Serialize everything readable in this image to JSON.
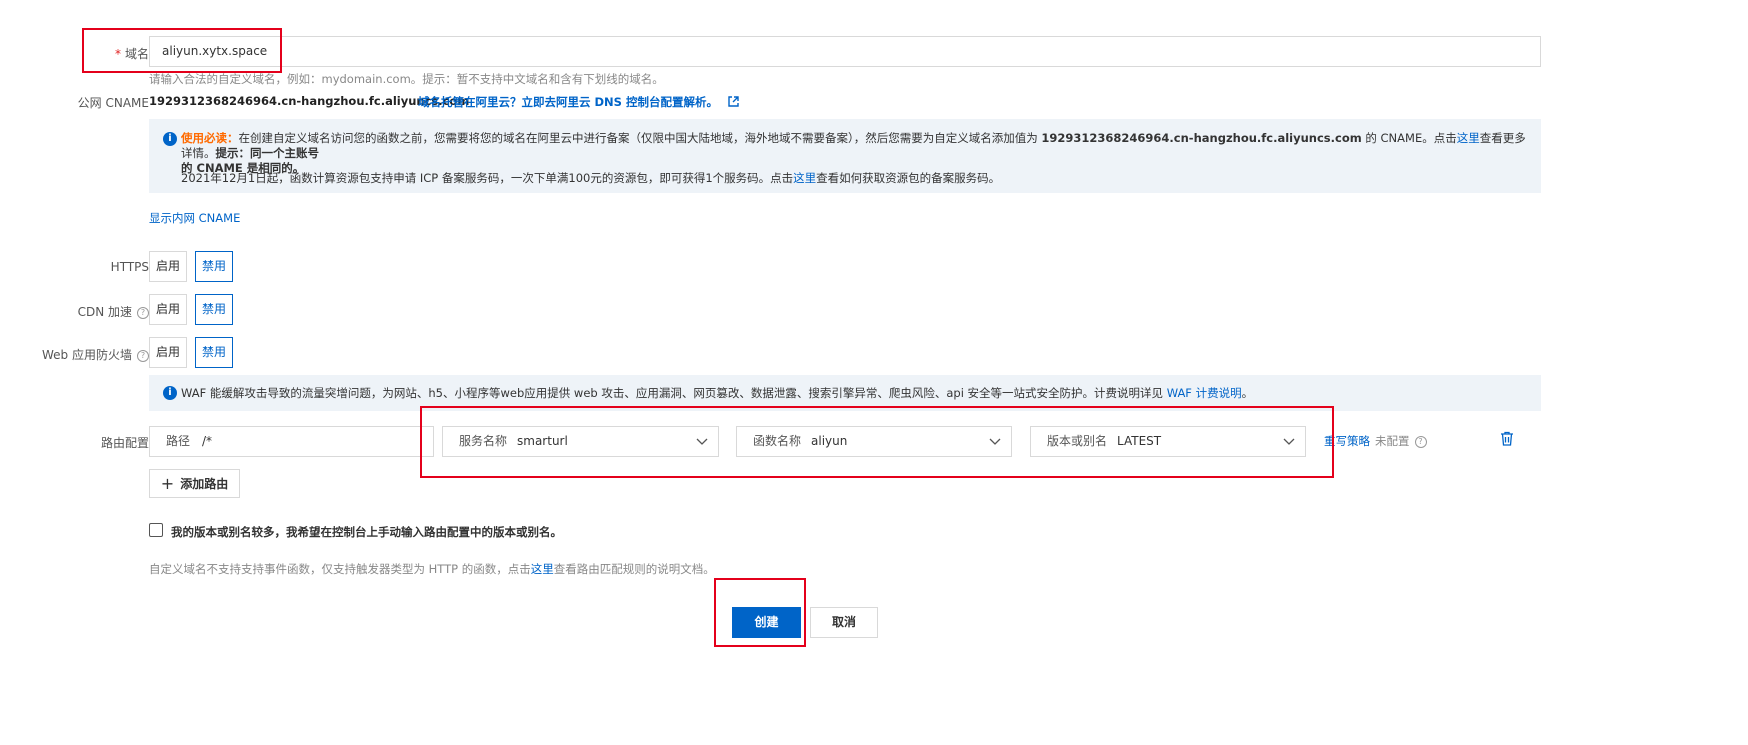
{
  "domain": {
    "label": "域名",
    "required_mark": "*",
    "value": "aliyun.xytx.space",
    "help": "请输入合法的自定义域名，例如：mydomain.com。提示：暂不支持中文域名和含有下划线的域名。"
  },
  "cname": {
    "label": "公网 CNAME",
    "value": "1929312368246964.cn-hangzhou.fc.aliyuncs.com",
    "dns_link": "域名托管在阿里云？立即去阿里云 DNS 控制台配置解析。",
    "show_internal_link": "显示内网 CNAME"
  },
  "notice1": {
    "title": "使用必读：",
    "text1": "在创建自定义域名访问您的函数之前，您需要将您的域名在阿里云中进行备案（仅限中国大陆地域，海外地域不需要备案），然后您需要为自定义域名添加值为",
    "cname_value": "1929312368246964.cn-hangzhou.fc.aliyuncs.com",
    "text2": "的 CNAME。点击",
    "here1": "这里",
    "text3": "查看更多详情。",
    "tip_bold": "提示：同一个主账号",
    "tip_bold2": "的 CNAME 是相同的。",
    "line2a": "2021年12月1日起，函数计算资源包支持申请 ICP 备案服务码，一次下单满100元的资源包，即可获得1个服务码。点击",
    "here2": "这里",
    "line2b": "查看如何获取资源包的备案服务码。"
  },
  "https": {
    "label": "HTTPS",
    "enable": "启用",
    "disable": "禁用"
  },
  "cdn": {
    "label": "CDN 加速",
    "enable": "启用",
    "disable": "禁用"
  },
  "waf": {
    "label": "Web 应用防火墙",
    "enable": "启用",
    "disable": "禁用",
    "notice": "WAF 能缓解攻击导致的流量突增问题，为网站、h5、小程序等web应用提供 web 攻击、应用漏洞、网页篡改、数据泄露、搜索引擎异常、爬虫风险、api 安全等一站式安全防护。计费说明详见",
    "notice_link": "WAF 计费说明",
    "notice_end": "。"
  },
  "route": {
    "label": "路由配置",
    "path_prefix": "路径",
    "path_value": "/*",
    "service_prefix": "服务名称",
    "service_value": "smarturl",
    "function_prefix": "函数名称",
    "function_value": "aliyun",
    "version_prefix": "版本或别名",
    "version_value": "LATEST",
    "rewrite_link": "重写策略",
    "rewrite_status": "未配置",
    "add_route": "添加路由"
  },
  "manual_checkbox": "我的版本或别名较多，我希望在控制台上手动输入路由配置中的版本或别名。",
  "footer_note": {
    "text1": "自定义域名不支持支持事件函数，仅支持触发器类型为 HTTP 的函数，点击",
    "here": "这里",
    "text2": "查看路由匹配规则的说明文档。"
  },
  "actions": {
    "create": "创建",
    "cancel": "取消"
  },
  "colors": {
    "primary": "#0064c8",
    "highlight": "#e4001b",
    "notice_bg": "#eef3f8"
  }
}
